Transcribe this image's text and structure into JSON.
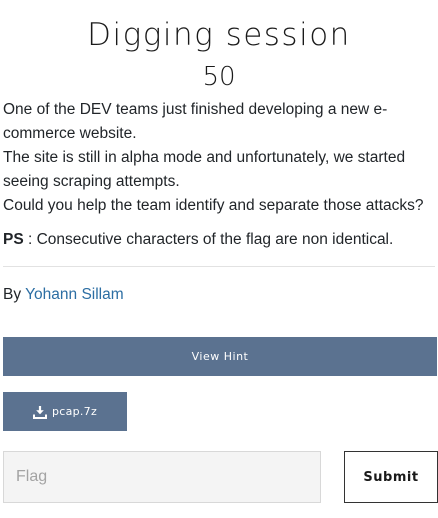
{
  "challenge": {
    "name": "Digging session",
    "value": "50"
  },
  "description": {
    "lines": [
      "One of the DEV teams just finished developing a new e-commerce website.",
      "The site is still in alpha mode and unfortunately, we started seeing scraping attempts.",
      "Could you help the team identify and separate those attacks?"
    ],
    "ps_label": "PS",
    "ps_text": " : Consecutive characters of the flag are non identical."
  },
  "author": {
    "prefix": "By ",
    "name": "Yohann Sillam"
  },
  "hint": {
    "label": "View Hint"
  },
  "file": {
    "label": "pcap.7z",
    "icon": "download-icon"
  },
  "submission": {
    "placeholder": "Flag",
    "value": "",
    "submit_label": "Submit"
  },
  "colors": {
    "button_bg": "#5b7290",
    "link": "#2c6ea3",
    "input_bg": "#f4f4f4"
  }
}
